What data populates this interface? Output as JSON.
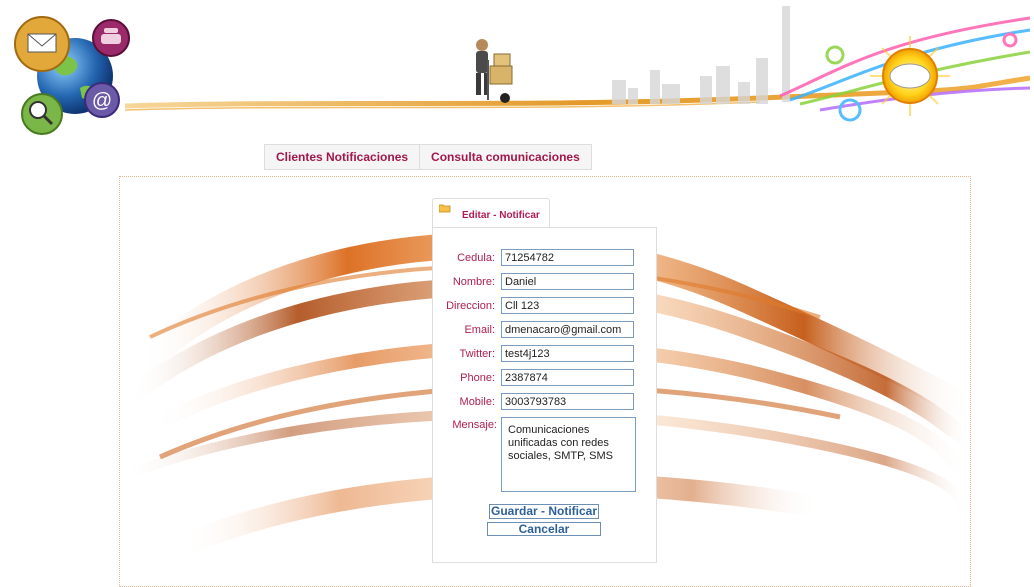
{
  "nav": {
    "tabs": [
      {
        "label": "Clientes Notificaciones"
      },
      {
        "label": "Consulta comunicaciones"
      }
    ]
  },
  "form": {
    "title": "Editar - Notificar",
    "fields": [
      {
        "label": "Cedula:",
        "value": "71254782"
      },
      {
        "label": "Nombre:",
        "value": "Daniel"
      },
      {
        "label": "Direccion:",
        "value": "Cll 123"
      },
      {
        "label": "Email:",
        "value": "dmenacaro@gmail.com"
      },
      {
        "label": "Twitter:",
        "value": "test4j123"
      },
      {
        "label": "Phone:",
        "value": "2387874"
      },
      {
        "label": "Mobile:",
        "value": "3003793783"
      }
    ],
    "message": {
      "label": "Mensaje:",
      "value": "Comunicaciones unificadas con redes sociales, SMTP, SMS"
    },
    "save_label": "Guardar - Notificar",
    "cancel_label": "Cancelar"
  },
  "colors": {
    "label": "#b0204f",
    "tab_text": "#a1184a",
    "button_text": "#2d5f9a",
    "input_border": "#7a9cbf",
    "swoosh": "#d9620f"
  },
  "icons": [
    "email-icon",
    "telephone-icon",
    "globe-icon",
    "magnifier-icon",
    "at-sign-icon",
    "delivery-man-icon",
    "city-skyline-icon",
    "sp-logo-icon",
    "folder-icon"
  ]
}
